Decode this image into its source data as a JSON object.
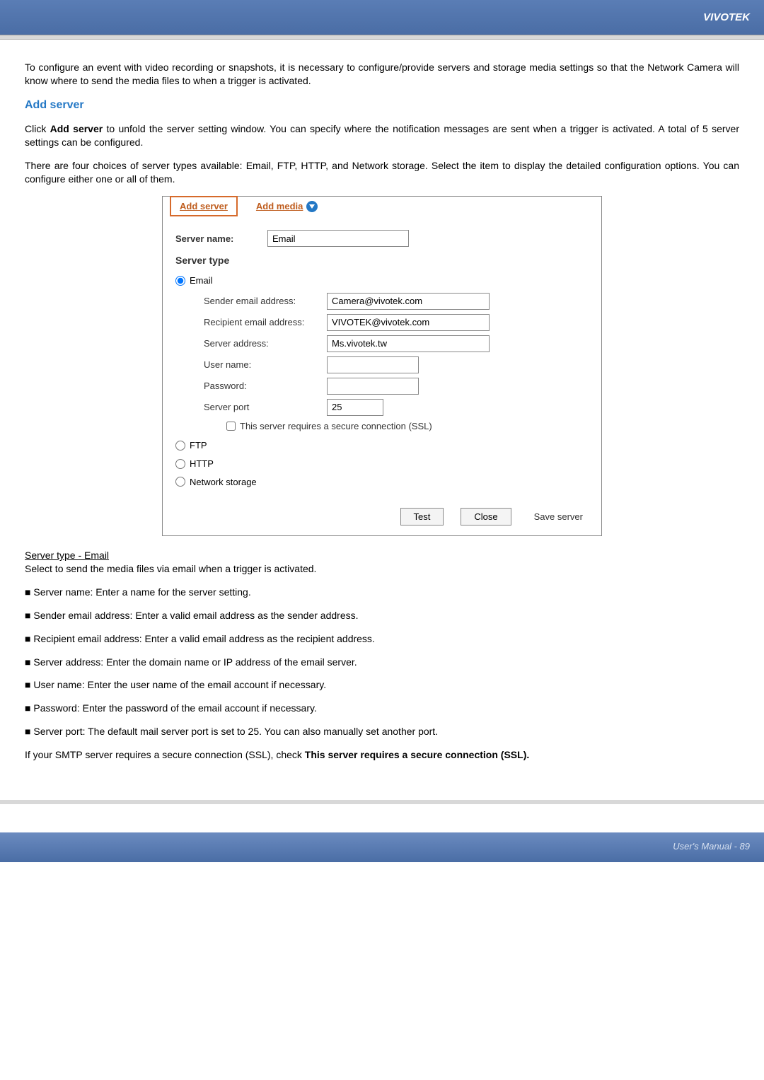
{
  "header": {
    "brand": "VIVOTEK"
  },
  "intro": {
    "p1": "To configure an event with video recording or snapshots, it is necessary to configure/provide servers and storage media settings so that the Network Camera will know where to send the media files to when a trigger is activated."
  },
  "addserver": {
    "title": "Add server",
    "p1a": "Click ",
    "p1b": "Add server",
    "p1c": " to unfold the server setting window. You can specify where the notification messages are sent when a trigger is activated. A total of 5 server settings can be configured.",
    "p2": "There are four choices of server types available: Email, FTP, HTTP, and Network storage. Select the item to display the detailed configuration options. You can configure either one or all of them."
  },
  "ui": {
    "tabs": {
      "add_server": "Add server",
      "add_media": "Add media"
    },
    "server_name_label": "Server name:",
    "server_name_value": "Email",
    "server_type_label": "Server type",
    "radios": {
      "email": "Email",
      "ftp": "FTP",
      "http": "HTTP",
      "network": "Network storage"
    },
    "fields": {
      "sender_label": "Sender email address:",
      "sender_value": "Camera@vivotek.com",
      "recipient_label": "Recipient email address:",
      "recipient_value": "VIVOTEK@vivotek.com",
      "server_addr_label": "Server address:",
      "server_addr_value": "Ms.vivotek.tw",
      "user_label": "User name:",
      "user_value": "",
      "pass_label": "Password:",
      "pass_value": "",
      "port_label": "Server port",
      "port_value": "25",
      "ssl_label": "This server requires a secure connection (SSL)"
    },
    "buttons": {
      "test": "Test",
      "close": "Close",
      "save": "Save server"
    }
  },
  "desc": {
    "header": "Server type - Email",
    "p1": "Select to send the media files via email when a trigger is activated.",
    "b1": "Server name: Enter a name for the server setting.",
    "b2": "Sender email address: Enter a valid email address as the sender address.",
    "b3": "Recipient email address: Enter a valid email address as the recipient address.",
    "b4": "Server address: Enter the domain name or IP address of the email server.",
    "b5": "User name: Enter the user name of the email account if necessary.",
    "b6": "Password: Enter the password of the email account if necessary.",
    "b7": "Server port: The default mail server port is set to 25. You can also manually set another port.",
    "p2a": "If your SMTP server requires a secure connection (SSL), check ",
    "p2b": "This server requires a secure connection (SSL)."
  },
  "footer": {
    "text": "User's Manual - 89"
  }
}
